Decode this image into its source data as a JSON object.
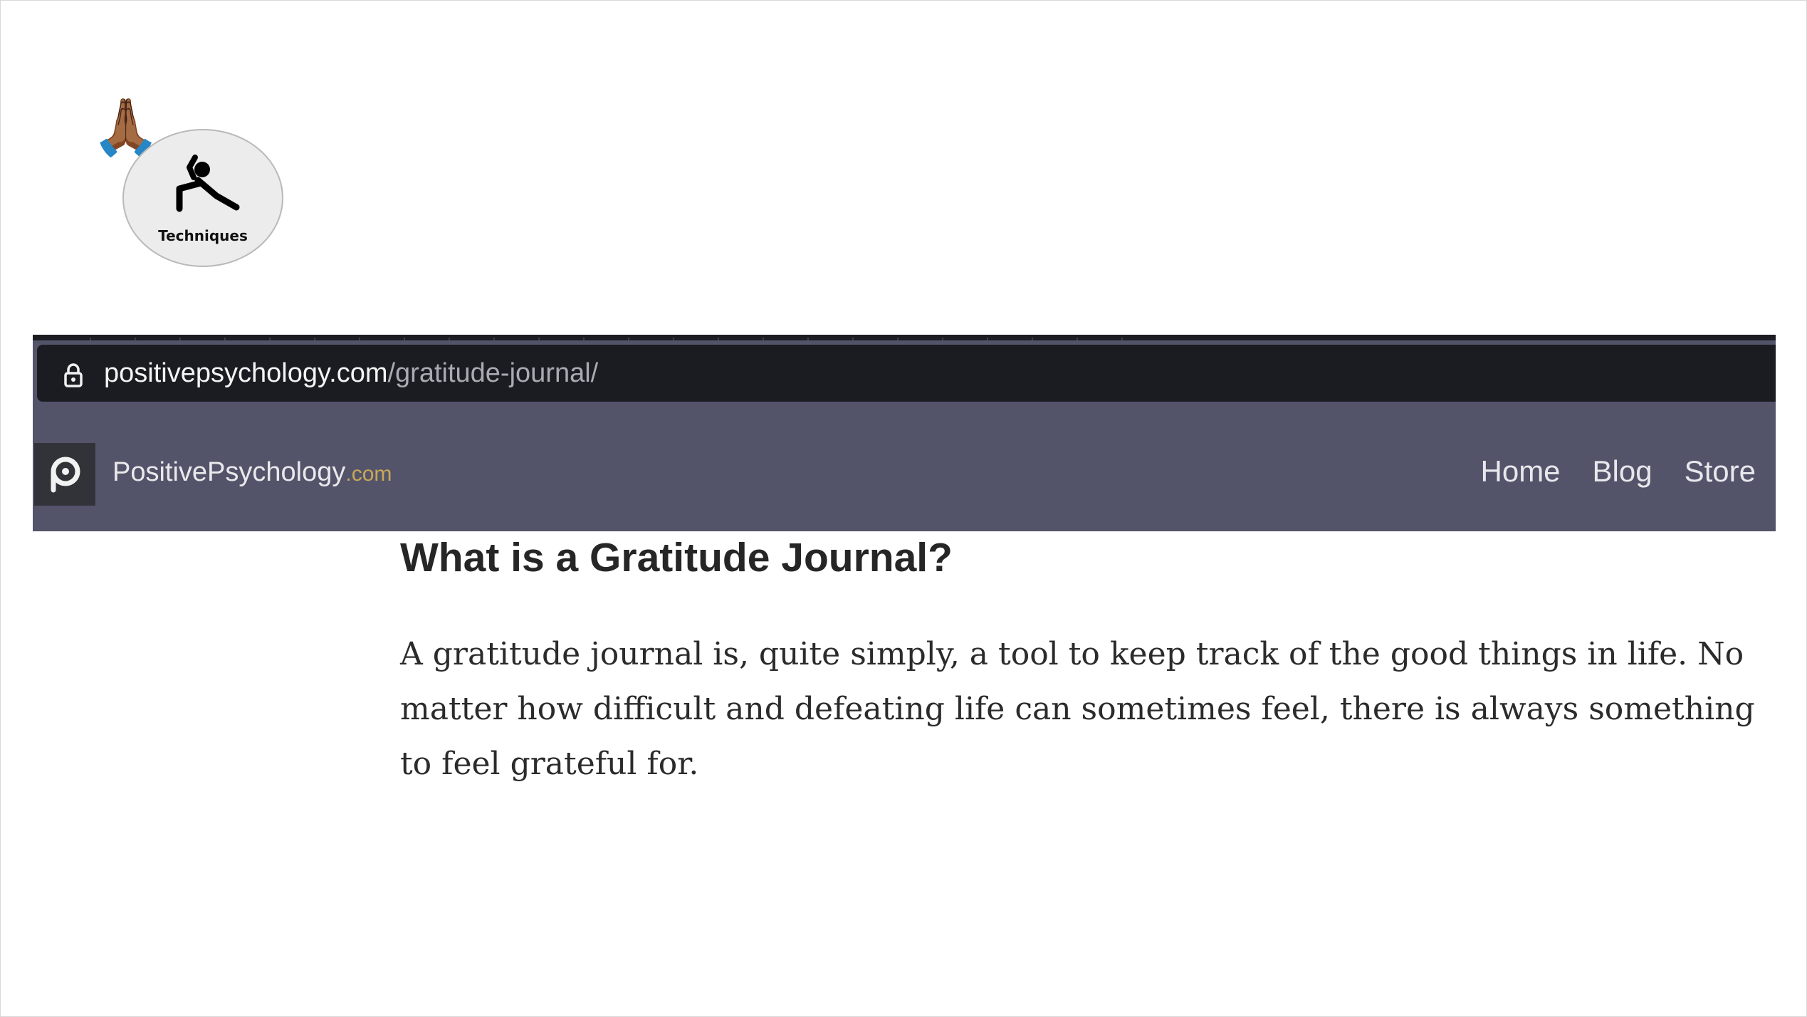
{
  "slide": {
    "badge": {
      "label": "Techniques"
    }
  },
  "browser": {
    "url": {
      "domain": "positivepsychology.com",
      "path": "/gratitude-journal/"
    }
  },
  "site": {
    "name": "PositivePsychology",
    "tld": ".com",
    "nav": [
      "Home",
      "Blog",
      "Store"
    ]
  },
  "article": {
    "title": "What is a Gratitude Journal?",
    "body": "A gratitude journal is, quite simply, a tool to keep track of the good things in life. No matter how difficult and defeating life can sometimes feel, there is always something to feel grateful for."
  }
}
